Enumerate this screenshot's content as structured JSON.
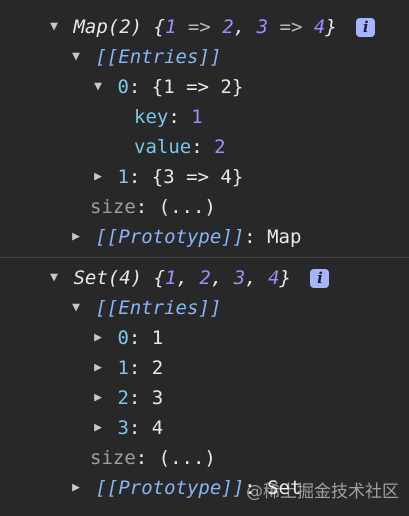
{
  "map": {
    "header": {
      "type_label": "Map(2)",
      "open_brace": "{",
      "close_brace": "}",
      "pairs": [
        {
          "k": "1",
          "arrow": "=>",
          "v": "2"
        },
        {
          "k": "3",
          "arrow": "=>",
          "v": "4"
        }
      ]
    },
    "entries_label": "[[Entries]]",
    "entry0": {
      "index": "0",
      "value": "{1 => 2}"
    },
    "entry0_key": {
      "label": "key",
      "value": "1"
    },
    "entry0_value": {
      "label": "value",
      "value": "2"
    },
    "entry1": {
      "index": "1",
      "value": "{3 => 4}"
    },
    "size": {
      "label": "size",
      "value": "(...)"
    },
    "prototype": {
      "label": "[[Prototype]]",
      "value": "Map"
    }
  },
  "set": {
    "header": {
      "type_label": "Set(4)",
      "open_brace": "{",
      "close_brace": "}",
      "items": [
        "1",
        "2",
        "3",
        "4"
      ]
    },
    "entries_label": "[[Entries]]",
    "entries": [
      {
        "index": "0",
        "value": "1"
      },
      {
        "index": "1",
        "value": "2"
      },
      {
        "index": "2",
        "value": "3"
      },
      {
        "index": "3",
        "value": "4"
      }
    ],
    "size": {
      "label": "size",
      "value": "(...)"
    },
    "prototype": {
      "label": "[[Prototype]]",
      "value": "Set"
    }
  },
  "info_icon_glyph": "i",
  "watermark": "@稀土掘金技术社区"
}
